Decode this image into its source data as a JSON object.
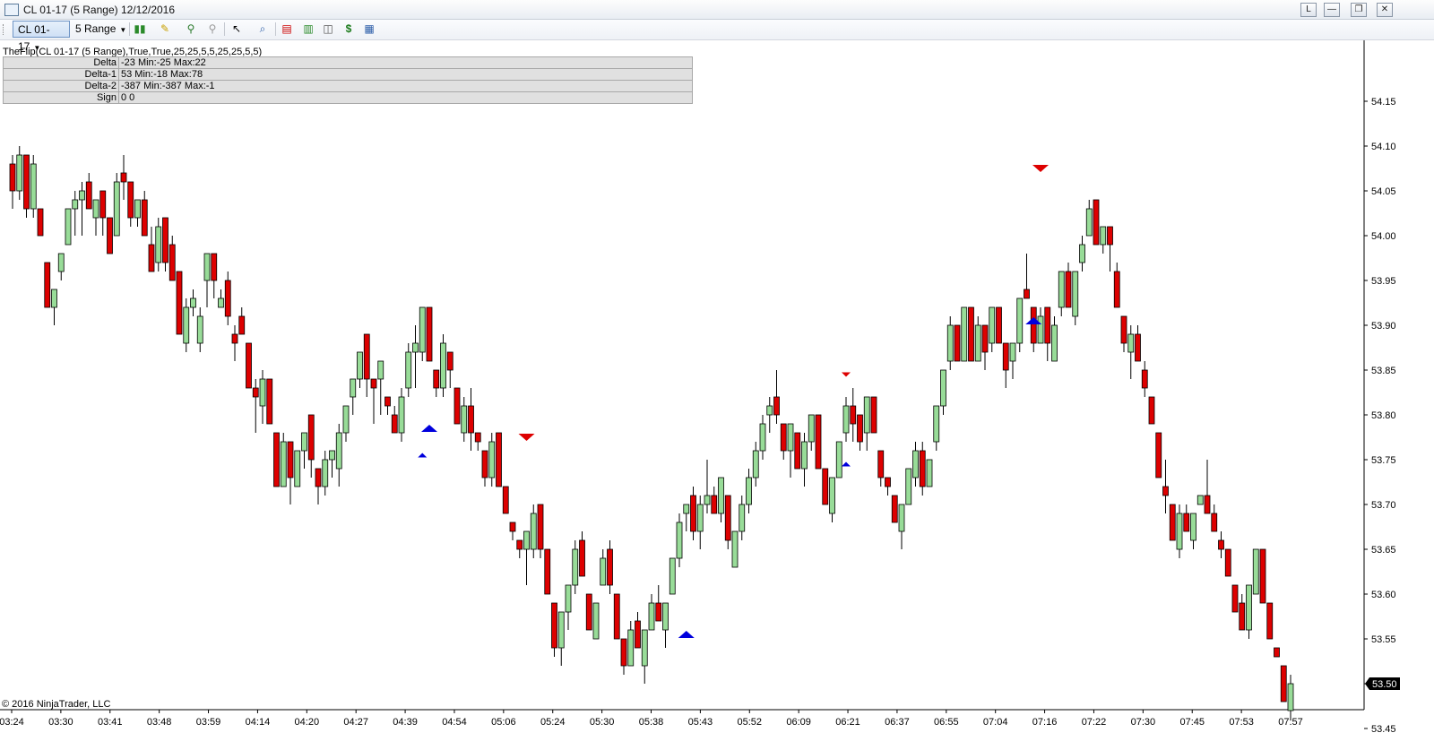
{
  "window": {
    "title": "CL 01-17 (5 Range)  12/12/2016",
    "buttons": [
      "L",
      "—",
      "❐",
      "✕"
    ]
  },
  "toolbar": {
    "instrument": "CL 01-17",
    "period": "5 Range",
    "icons": [
      "chart-style-icon",
      "drawing-tool-icon",
      "pin-icon",
      "pin-gray-icon",
      "cursor-icon",
      "zoom-icon",
      "indicators-icon",
      "strategies-icon",
      "properties-icon",
      "dollar-icon",
      "data-box-icon"
    ]
  },
  "indicator": {
    "label": "TheFlip(CL 01-17 (5 Range),True,True,25,25,5,5,25,25,5,5)",
    "rows": [
      {
        "name": "Delta",
        "value": "-23 Min:-25 Max:22"
      },
      {
        "name": "Delta-1",
        "value": "53 Min:-18 Max:78"
      },
      {
        "name": "Delta-2",
        "value": "-387 Min:-387 Max:-1"
      },
      {
        "name": "Sign",
        "value": "0 0"
      }
    ]
  },
  "copyright": "© 2016 NinjaTrader, LLC",
  "colors": {
    "up": "#98dc98",
    "down": "#dd0000",
    "buy_marker": "#0000dd",
    "sell_marker": "#dd0000",
    "price_tag": "#000000"
  },
  "chart_data": {
    "type": "candlestick",
    "yaxis": {
      "ticks": [
        "54.15",
        "54.10",
        "54.05",
        "54.00",
        "53.95",
        "53.90",
        "53.85",
        "53.80",
        "53.75",
        "53.70",
        "53.65",
        "53.60",
        "53.55",
        "53.50",
        "53.45"
      ],
      "range": [
        53.425,
        54.17
      ]
    },
    "xaxis": {
      "ticks": [
        "03:24",
        "03:30",
        "03:41",
        "03:48",
        "03:59",
        "04:14",
        "04:20",
        "04:27",
        "04:39",
        "04:54",
        "05:06",
        "05:24",
        "05:30",
        "05:38",
        "05:43",
        "05:52",
        "06:09",
        "06:21",
        "06:37",
        "06:55",
        "07:04",
        "07:16",
        "07:22",
        "07:30",
        "07:45",
        "07:53",
        "07:57"
      ]
    },
    "last_price": "53.50",
    "candles": [
      [
        54.08,
        54.05,
        54.09,
        54.03
      ],
      [
        54.05,
        54.09,
        54.1,
        54.04
      ],
      [
        54.09,
        54.03,
        54.09,
        54.02
      ],
      [
        54.03,
        54.08,
        54.09,
        54.02
      ],
      [
        54.03,
        54.0,
        54.03,
        54.0
      ],
      [
        53.97,
        53.92,
        53.97,
        53.92
      ],
      [
        53.92,
        53.94,
        53.94,
        53.9
      ],
      [
        53.96,
        53.98,
        53.98,
        53.95
      ],
      [
        53.99,
        54.03,
        54.03,
        53.99
      ],
      [
        54.03,
        54.04,
        54.05,
        54.0
      ],
      [
        54.04,
        54.05,
        54.06,
        54.0
      ],
      [
        54.06,
        54.03,
        54.07,
        54.03
      ],
      [
        54.02,
        54.04,
        54.04,
        54.0
      ],
      [
        54.05,
        54.02,
        54.05,
        54.0
      ],
      [
        54.02,
        53.98,
        54.02,
        53.98
      ],
      [
        54.0,
        54.06,
        54.07,
        54.0
      ],
      [
        54.07,
        54.06,
        54.09,
        54.04
      ],
      [
        54.06,
        54.02,
        54.06,
        54.01
      ],
      [
        54.02,
        54.04,
        54.04,
        54.01
      ],
      [
        54.04,
        54.0,
        54.05,
        54.0
      ],
      [
        53.99,
        53.96,
        54.01,
        53.96
      ],
      [
        53.97,
        54.01,
        54.02,
        53.96
      ],
      [
        54.02,
        53.97,
        54.02,
        53.96
      ],
      [
        53.99,
        53.95,
        54.0,
        53.95
      ],
      [
        53.96,
        53.89,
        53.96,
        53.89
      ],
      [
        53.88,
        53.92,
        53.93,
        53.87
      ],
      [
        53.92,
        53.93,
        53.94,
        53.91
      ],
      [
        53.88,
        53.91,
        53.92,
        53.87
      ],
      [
        53.95,
        53.98,
        53.98,
        53.92
      ],
      [
        53.98,
        53.95,
        53.98,
        53.93
      ],
      [
        53.92,
        53.93,
        53.94,
        53.92
      ],
      [
        53.95,
        53.91,
        53.96,
        53.9
      ],
      [
        53.89,
        53.88,
        53.9,
        53.86
      ],
      [
        53.91,
        53.89,
        53.92,
        53.89
      ],
      [
        53.88,
        53.83,
        53.88,
        53.83
      ],
      [
        53.83,
        53.82,
        53.84,
        53.78
      ],
      [
        53.81,
        53.84,
        53.85,
        53.79
      ],
      [
        53.84,
        53.79,
        53.84,
        53.79
      ],
      [
        53.78,
        53.72,
        53.78,
        53.72
      ],
      [
        53.72,
        53.77,
        53.78,
        53.72
      ],
      [
        53.77,
        53.73,
        53.77,
        53.7
      ],
      [
        53.72,
        53.76,
        53.76,
        53.72
      ],
      [
        53.76,
        53.78,
        53.78,
        53.74
      ],
      [
        53.8,
        53.75,
        53.8,
        53.73
      ],
      [
        53.74,
        53.72,
        53.74,
        53.7
      ],
      [
        53.72,
        53.75,
        53.76,
        53.71
      ],
      [
        53.75,
        53.76,
        53.76,
        53.73
      ],
      [
        53.74,
        53.78,
        53.79,
        53.72
      ],
      [
        53.78,
        53.81,
        53.81,
        53.77
      ],
      [
        53.82,
        53.84,
        53.84,
        53.8
      ],
      [
        53.84,
        53.87,
        53.87,
        53.83
      ],
      [
        53.89,
        53.84,
        53.89,
        53.82
      ],
      [
        53.84,
        53.83,
        53.84,
        53.79
      ],
      [
        53.84,
        53.86,
        53.86,
        53.8
      ],
      [
        53.82,
        53.81,
        53.82,
        53.8
      ],
      [
        53.8,
        53.78,
        53.81,
        53.78
      ],
      [
        53.78,
        53.82,
        53.83,
        53.77
      ],
      [
        53.83,
        53.87,
        53.88,
        53.82
      ],
      [
        53.87,
        53.88,
        53.9,
        53.83
      ],
      [
        53.87,
        53.92,
        53.92,
        53.86
      ],
      [
        53.92,
        53.86,
        53.92,
        53.86
      ],
      [
        53.85,
        53.83,
        53.85,
        53.82
      ],
      [
        53.83,
        53.88,
        53.89,
        53.82
      ],
      [
        53.87,
        53.85,
        53.87,
        53.83
      ],
      [
        53.83,
        53.79,
        53.83,
        53.79
      ],
      [
        53.78,
        53.81,
        53.82,
        53.77
      ],
      [
        53.81,
        53.78,
        53.83,
        53.76
      ],
      [
        53.78,
        53.77,
        53.78,
        53.76
      ],
      [
        53.76,
        53.73,
        53.76,
        53.72
      ],
      [
        53.73,
        53.77,
        53.78,
        53.72
      ],
      [
        53.78,
        53.72,
        53.78,
        53.72
      ],
      [
        53.72,
        53.69,
        53.72,
        53.69
      ],
      [
        53.68,
        53.67,
        53.68,
        53.66
      ],
      [
        53.66,
        53.65,
        53.66,
        53.64
      ],
      [
        53.65,
        53.67,
        53.67,
        53.61
      ],
      [
        53.65,
        53.69,
        53.7,
        53.64
      ],
      [
        53.7,
        53.65,
        53.7,
        53.64
      ],
      [
        53.65,
        53.6,
        53.65,
        53.6
      ],
      [
        53.59,
        53.54,
        53.59,
        53.53
      ],
      [
        53.54,
        53.58,
        53.58,
        53.52
      ],
      [
        53.58,
        53.61,
        53.61,
        53.56
      ],
      [
        53.61,
        53.65,
        53.66,
        53.6
      ],
      [
        53.66,
        53.62,
        53.67,
        53.62
      ],
      [
        53.6,
        53.56,
        53.6,
        53.56
      ],
      [
        53.55,
        53.59,
        53.59,
        53.55
      ],
      [
        53.61,
        53.64,
        53.65,
        53.61
      ],
      [
        53.65,
        53.61,
        53.66,
        53.6
      ],
      [
        53.6,
        53.55,
        53.6,
        53.55
      ],
      [
        53.55,
        53.52,
        53.55,
        53.51
      ],
      [
        53.52,
        53.56,
        53.57,
        53.52
      ],
      [
        53.57,
        53.54,
        53.58,
        53.54
      ],
      [
        53.52,
        53.56,
        53.56,
        53.5
      ],
      [
        53.56,
        53.59,
        53.6,
        53.56
      ],
      [
        53.59,
        53.57,
        53.61,
        53.57
      ],
      [
        53.56,
        53.59,
        53.59,
        53.54
      ],
      [
        53.6,
        53.64,
        53.64,
        53.6
      ],
      [
        53.64,
        53.68,
        53.69,
        53.63
      ],
      [
        53.69,
        53.7,
        53.7,
        53.67
      ],
      [
        53.71,
        53.67,
        53.72,
        53.66
      ],
      [
        53.67,
        53.7,
        53.71,
        53.65
      ],
      [
        53.7,
        53.71,
        53.75,
        53.69
      ],
      [
        53.71,
        53.69,
        53.72,
        53.69
      ],
      [
        53.69,
        53.73,
        53.73,
        53.68
      ],
      [
        53.71,
        53.66,
        53.71,
        53.65
      ],
      [
        53.63,
        53.67,
        53.67,
        53.63
      ],
      [
        53.67,
        53.7,
        53.71,
        53.66
      ],
      [
        53.7,
        53.73,
        53.74,
        53.69
      ],
      [
        53.73,
        53.76,
        53.77,
        53.72
      ],
      [
        53.76,
        53.79,
        53.8,
        53.75
      ],
      [
        53.8,
        53.81,
        53.82,
        53.78
      ],
      [
        53.82,
        53.8,
        53.85,
        53.79
      ],
      [
        53.79,
        53.76,
        53.79,
        53.75
      ],
      [
        53.76,
        53.79,
        53.79,
        53.73
      ],
      [
        53.78,
        53.74,
        53.78,
        53.74
      ],
      [
        53.74,
        53.77,
        53.78,
        53.72
      ],
      [
        53.77,
        53.8,
        53.8,
        53.76
      ],
      [
        53.8,
        53.74,
        53.8,
        53.74
      ],
      [
        53.74,
        53.7,
        53.74,
        53.7
      ],
      [
        53.69,
        53.73,
        53.73,
        53.68
      ],
      [
        53.73,
        53.77,
        53.77,
        53.73
      ],
      [
        53.78,
        53.81,
        53.82,
        53.77
      ],
      [
        53.81,
        53.79,
        53.83,
        53.77
      ],
      [
        53.8,
        53.77,
        53.8,
        53.76
      ],
      [
        53.78,
        53.82,
        53.82,
        53.76
      ],
      [
        53.82,
        53.78,
        53.82,
        53.78
      ],
      [
        53.76,
        53.73,
        53.76,
        53.72
      ],
      [
        53.73,
        53.72,
        53.73,
        53.71
      ],
      [
        53.71,
        53.68,
        53.71,
        53.68
      ],
      [
        53.67,
        53.7,
        53.7,
        53.65
      ],
      [
        53.7,
        53.74,
        53.74,
        53.7
      ],
      [
        53.73,
        53.76,
        53.77,
        53.72
      ],
      [
        53.76,
        53.72,
        53.77,
        53.71
      ],
      [
        53.72,
        53.75,
        53.75,
        53.72
      ],
      [
        53.77,
        53.81,
        53.81,
        53.76
      ],
      [
        53.81,
        53.85,
        53.85,
        53.8
      ],
      [
        53.86,
        53.9,
        53.91,
        53.85
      ],
      [
        53.9,
        53.86,
        53.9,
        53.86
      ],
      [
        53.86,
        53.92,
        53.92,
        53.86
      ],
      [
        53.92,
        53.86,
        53.92,
        53.86
      ],
      [
        53.86,
        53.9,
        53.91,
        53.86
      ],
      [
        53.9,
        53.87,
        53.9,
        53.85
      ],
      [
        53.88,
        53.92,
        53.92,
        53.87
      ],
      [
        53.92,
        53.88,
        53.92,
        53.88
      ],
      [
        53.88,
        53.85,
        53.88,
        53.83
      ],
      [
        53.86,
        53.88,
        53.88,
        53.84
      ],
      [
        53.88,
        53.93,
        53.93,
        53.87
      ],
      [
        53.94,
        53.93,
        53.98,
        53.93
      ],
      [
        53.92,
        53.88,
        53.92,
        53.87
      ],
      [
        53.88,
        53.91,
        53.92,
        53.88
      ],
      [
        53.92,
        53.88,
        53.92,
        53.86
      ],
      [
        53.86,
        53.9,
        53.91,
        53.86
      ],
      [
        53.92,
        53.96,
        53.96,
        53.91
      ],
      [
        53.96,
        53.92,
        53.97,
        53.92
      ],
      [
        53.91,
        53.96,
        53.96,
        53.9
      ],
      [
        53.97,
        53.99,
        54.0,
        53.96
      ],
      [
        54.0,
        54.03,
        54.04,
        54.0
      ],
      [
        54.04,
        53.99,
        54.04,
        53.99
      ],
      [
        53.99,
        54.01,
        54.01,
        53.98
      ],
      [
        54.01,
        53.99,
        54.01,
        53.96
      ],
      [
        53.96,
        53.92,
        53.97,
        53.92
      ],
      [
        53.91,
        53.88,
        53.91,
        53.87
      ],
      [
        53.87,
        53.89,
        53.9,
        53.84
      ],
      [
        53.89,
        53.86,
        53.9,
        53.86
      ],
      [
        53.85,
        53.83,
        53.86,
        53.82
      ],
      [
        53.82,
        53.79,
        53.82,
        53.79
      ],
      [
        53.78,
        53.73,
        53.78,
        53.73
      ],
      [
        53.72,
        53.71,
        53.75,
        53.69
      ],
      [
        53.7,
        53.66,
        53.7,
        53.66
      ],
      [
        53.65,
        53.69,
        53.7,
        53.64
      ],
      [
        53.69,
        53.67,
        53.7,
        53.67
      ],
      [
        53.66,
        53.69,
        53.69,
        53.65
      ],
      [
        53.7,
        53.71,
        53.71,
        53.7
      ],
      [
        53.71,
        53.69,
        53.75,
        53.69
      ],
      [
        53.69,
        53.67,
        53.7,
        53.67
      ],
      [
        53.66,
        53.65,
        53.67,
        53.64
      ],
      [
        53.65,
        53.62,
        53.65,
        53.62
      ],
      [
        53.61,
        53.58,
        53.61,
        53.58
      ],
      [
        53.59,
        53.56,
        53.6,
        53.56
      ],
      [
        53.56,
        53.61,
        53.61,
        53.55
      ],
      [
        53.6,
        53.65,
        53.65,
        53.6
      ],
      [
        53.65,
        53.59,
        53.65,
        53.59
      ],
      [
        53.59,
        53.55,
        53.59,
        53.55
      ],
      [
        53.54,
        53.53,
        53.54,
        53.53
      ],
      [
        53.52,
        53.48,
        53.52,
        53.48
      ],
      [
        53.47,
        53.5,
        53.51,
        53.46
      ]
    ],
    "signals": [
      {
        "type": "sell",
        "bar": 148,
        "price": 54.075
      },
      {
        "type": "buy",
        "bar": 60,
        "price": 53.785
      },
      {
        "type": "buy",
        "bar": 59,
        "price": 53.755,
        "size": "small"
      },
      {
        "type": "sell",
        "bar": 74,
        "price": 53.775
      },
      {
        "type": "buy",
        "bar": 97,
        "price": 53.555
      },
      {
        "type": "sell",
        "bar": 120,
        "price": 53.845,
        "size": "small"
      },
      {
        "type": "buy",
        "bar": 120,
        "price": 53.745,
        "size": "small"
      },
      {
        "type": "buy",
        "bar": 147,
        "price": 53.905
      }
    ]
  }
}
